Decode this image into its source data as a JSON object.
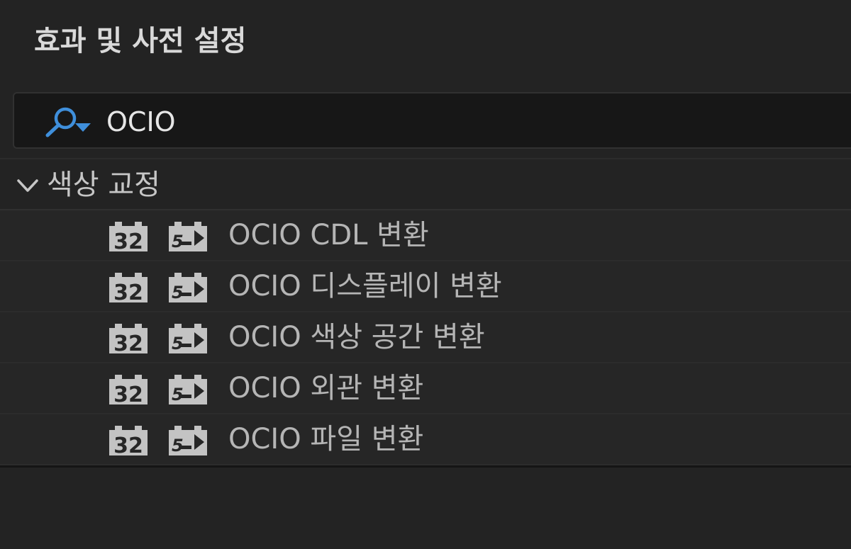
{
  "panel": {
    "title": "효과 및 사전 설정"
  },
  "search": {
    "value": "OCIO",
    "icon": "search-icon",
    "accent_color": "#3f8fdb"
  },
  "group": {
    "label": "색상 교정",
    "expanded": true
  },
  "items": [
    {
      "label": "OCIO CDL 변환",
      "badges": [
        "32",
        "gpu-accelerated"
      ]
    },
    {
      "label": "OCIO 디스플레이 변환",
      "badges": [
        "32",
        "gpu-accelerated"
      ]
    },
    {
      "label": "OCIO 색상 공간 변환",
      "badges": [
        "32",
        "gpu-accelerated"
      ]
    },
    {
      "label": "OCIO 외관 변환",
      "badges": [
        "32",
        "gpu-accelerated"
      ]
    },
    {
      "label": "OCIO 파일 변환",
      "badges": [
        "32",
        "gpu-accelerated"
      ]
    }
  ],
  "badge_text": "32"
}
